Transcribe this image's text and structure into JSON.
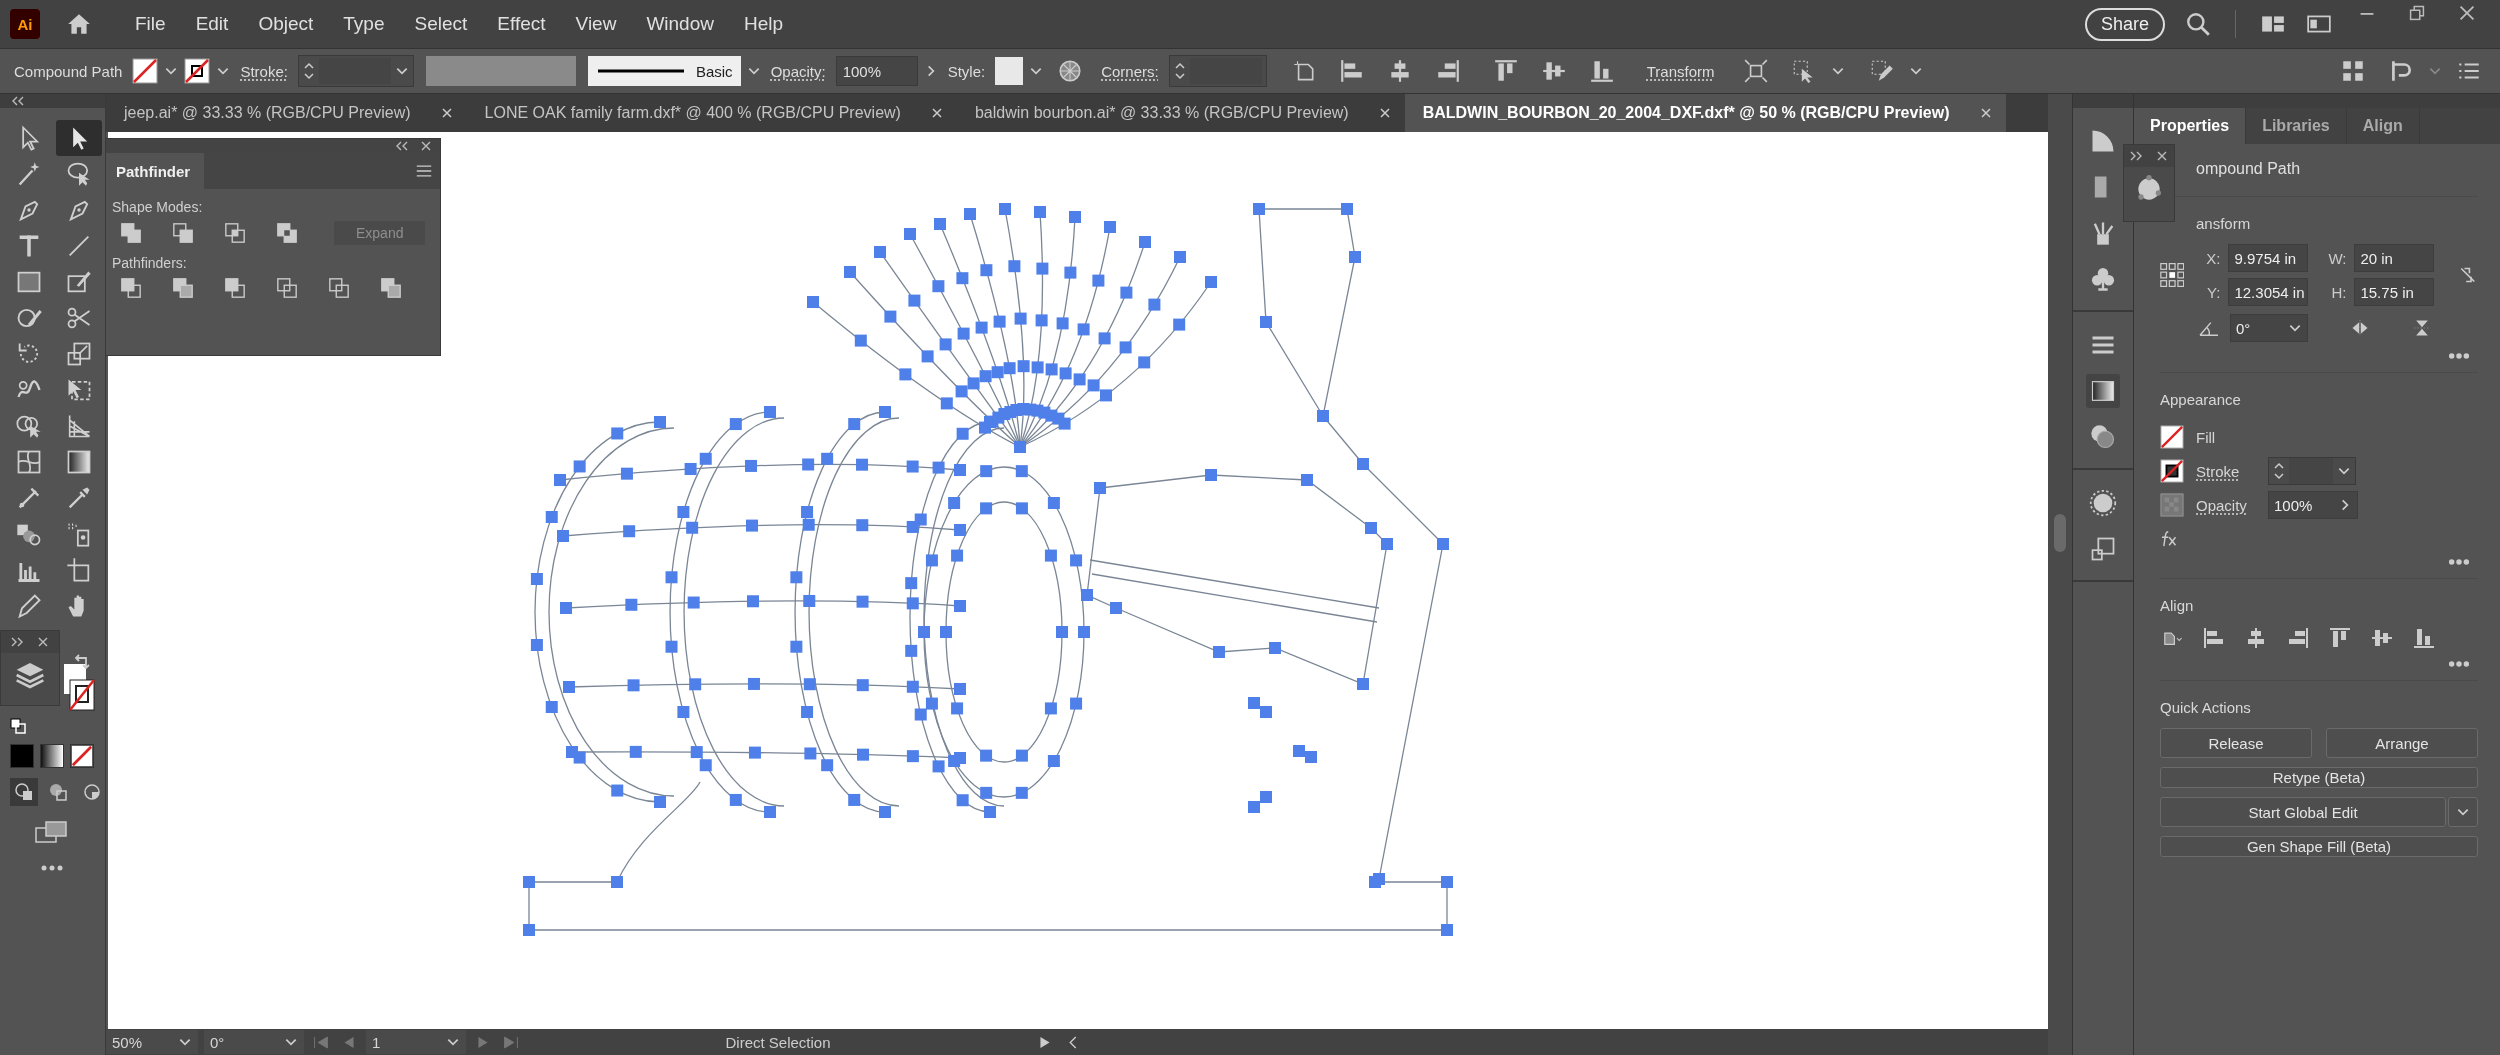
{
  "app": {
    "logo": "Ai"
  },
  "menu": [
    "File",
    "Edit",
    "Object",
    "Type",
    "Select",
    "Effect",
    "View",
    "Window",
    "Help"
  ],
  "share": "Share",
  "control_bar": {
    "selection": "Compound Path",
    "stroke_label": "Stroke:",
    "brush": "Basic",
    "opacity_label": "Opacity:",
    "opacity": "100%",
    "style_label": "Style:",
    "corners_label": "Corners:",
    "transform": "Transform"
  },
  "doc_tabs": [
    {
      "title": "jeep.ai* @ 33.33 % (RGB/CPU Preview)",
      "selected": false
    },
    {
      "title": "LONE OAK family farm.dxf* @ 400 % (RGB/CPU Preview)",
      "selected": false
    },
    {
      "title": "baldwin bourbon.ai* @ 33.33 % (RGB/CPU Preview)",
      "selected": false
    },
    {
      "title": "BALDWIN_BOURBON_20_2004_DXF.dxf* @ 50 % (RGB/CPU Preview)",
      "selected": true
    }
  ],
  "tools": [
    {
      "kind": "hollow-arrow",
      "selected": false
    },
    {
      "kind": "solid-arrow",
      "selected": true
    },
    {
      "kind": "wand",
      "selected": false
    },
    {
      "kind": "lasso",
      "selected": false
    },
    {
      "kind": "pen",
      "selected": false
    },
    {
      "kind": "pen",
      "selected": false
    },
    {
      "kind": "type",
      "selected": false
    },
    {
      "kind": "line",
      "selected": false
    },
    {
      "kind": "rectangle",
      "selected": false
    },
    {
      "kind": "brush",
      "selected": false
    },
    {
      "kind": "shaper",
      "selected": false
    },
    {
      "kind": "scissors",
      "selected": false
    },
    {
      "kind": "rotate",
      "selected": false
    },
    {
      "kind": "scale",
      "selected": false
    },
    {
      "kind": "warp",
      "selected": false
    },
    {
      "kind": "free-transform",
      "selected": false
    },
    {
      "kind": "shape-builder",
      "selected": false
    },
    {
      "kind": "perspective",
      "selected": false
    },
    {
      "kind": "mesh",
      "selected": false
    },
    {
      "kind": "gradient",
      "selected": false
    },
    {
      "kind": "blend",
      "selected": false
    },
    {
      "kind": "eyedropper",
      "selected": false
    },
    {
      "kind": "symbol",
      "selected": false
    },
    {
      "kind": "sprayer",
      "selected": false
    },
    {
      "kind": "graph",
      "selected": false
    },
    {
      "kind": "artboard",
      "selected": false
    },
    {
      "kind": "pencil",
      "selected": false
    },
    {
      "kind": "hand",
      "selected": false
    }
  ],
  "pathfinder": {
    "title": "Pathfinder",
    "shape_modes": "Shape Modes:",
    "expand": "Expand",
    "pathfinders": "Pathfinders:"
  },
  "properties": {
    "tabs": [
      {
        "label": "Properties",
        "selected": true
      },
      {
        "label": "Libraries",
        "selected": false
      },
      {
        "label": "Align",
        "selected": false
      }
    ],
    "object": "ompound Path",
    "transform": {
      "title": "ansform",
      "x_label": "X:",
      "x": "9.9754 in",
      "y_label": "Y:",
      "y": "12.3054 in",
      "w_label": "W:",
      "w": "20 in",
      "h_label": "H:",
      "h": "15.75 in",
      "angle": "0°"
    },
    "appearance": {
      "title": "Appearance",
      "fill": "Fill",
      "stroke": "Stroke",
      "opacity_label": "Opacity",
      "opacity": "100%"
    },
    "align": {
      "title": "Align"
    },
    "quick_actions": {
      "title": "Quick Actions",
      "buttons": [
        "Release",
        "Arrange",
        "Retype (Beta)",
        "Start Global Edit",
        "Gen Shape Fill (Beta)"
      ]
    }
  },
  "status_bar": {
    "zoom": "50%",
    "rotation": "0°",
    "artboard": "1",
    "tool": "Direct Selection"
  }
}
